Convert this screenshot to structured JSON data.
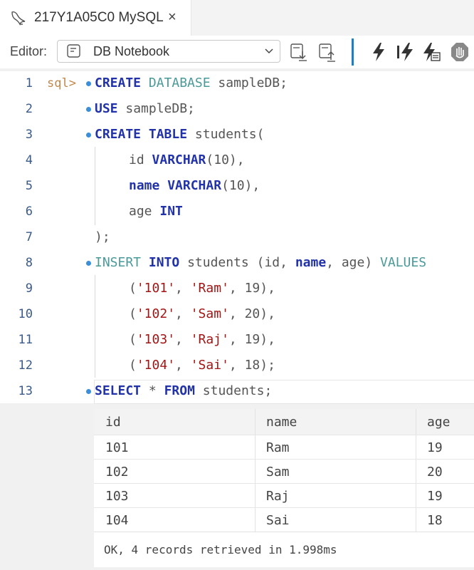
{
  "tab": {
    "title": "217Y1A05C0 MySQL",
    "close": "×",
    "icon": "dolphin-icon"
  },
  "toolbar": {
    "editor_label": "Editor:",
    "editor_value": "DB Notebook",
    "icons": [
      "load-script-icon",
      "save-script-icon",
      "execute-icon",
      "execute-step-icon",
      "execute-text-icon",
      "stop-icon"
    ],
    "accent": "#1b7fc4"
  },
  "editor": {
    "prompt": "sql>",
    "lines": [
      {
        "n": "1"
      },
      {
        "n": "2"
      },
      {
        "n": "3"
      },
      {
        "n": "4"
      },
      {
        "n": "5"
      },
      {
        "n": "6"
      },
      {
        "n": "7"
      },
      {
        "n": "8"
      },
      {
        "n": "9"
      },
      {
        "n": "10"
      },
      {
        "n": "11"
      },
      {
        "n": "12"
      },
      {
        "n": "13"
      }
    ],
    "tokens": {
      "create": "CREATE",
      "database": "DATABASE",
      "sampledb1": "sampleDB;",
      "use": "USE",
      "sampledb2": "sampleDB;",
      "create2": "CREATE",
      "table": "TABLE",
      "students_paren": "students(",
      "id": "id",
      "varchar1": "VARCHAR",
      "len1": "(10),",
      "name": "name",
      "varchar2": "VARCHAR",
      "len2": "(10),",
      "age": "age",
      "int": "INT",
      "close": ");",
      "insert": "INSERT",
      "into": "INTO",
      "students_cols": "students (id,",
      "name_col": "name",
      "age_col": ", age)",
      "values": "VALUES",
      "r1a": "(",
      "r1b": "'101'",
      "r1c": ", ",
      "r1d": "'Ram'",
      "r1e": ", 19),",
      "r2a": "(",
      "r2b": "'102'",
      "r2c": ", ",
      "r2d": "'Sam'",
      "r2e": ", 20),",
      "r3a": "(",
      "r3b": "'103'",
      "r3c": ", ",
      "r3d": "'Raj'",
      "r3e": ", 19),",
      "r4a": "(",
      "r4b": "'104'",
      "r4c": ", ",
      "r4d": "'Sai'",
      "r4e": ", 18);",
      "select": "SELECT",
      "star": "*",
      "from": "FROM",
      "students_end": "students;"
    },
    "colors": {
      "keyword": "#2233aa",
      "keyword_light": "#4a9a9a",
      "string": "#a31515",
      "line_number": "#3a5a8a",
      "prompt": "#c0884b"
    }
  },
  "result": {
    "columns": [
      "id",
      "name",
      "age"
    ],
    "rows": [
      [
        "101",
        "Ram",
        "19"
      ],
      [
        "102",
        "Sam",
        "20"
      ],
      [
        "103",
        "Raj",
        "19"
      ],
      [
        "104",
        "Sai",
        "18"
      ]
    ],
    "status": "OK, 4 records retrieved in 1.998ms"
  }
}
